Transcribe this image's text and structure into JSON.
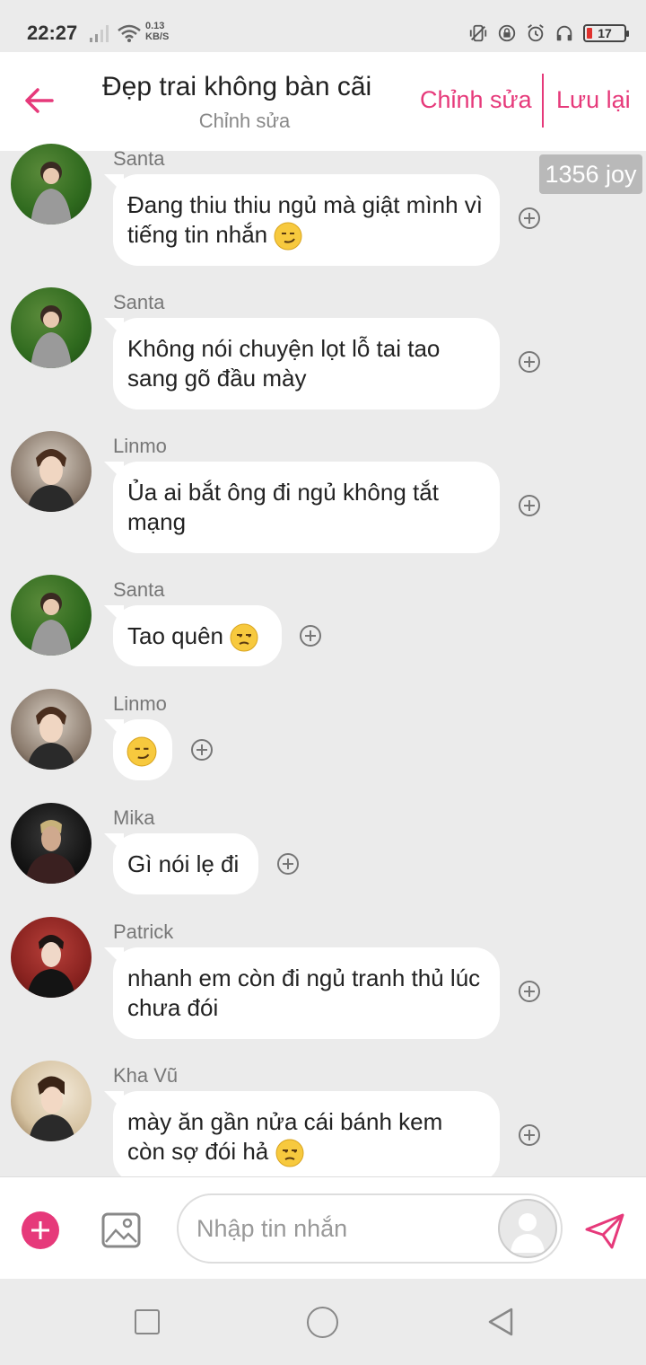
{
  "status_bar": {
    "time": "22:27",
    "speed_value": "0.13",
    "speed_unit": "KB/S",
    "battery": "17",
    "icons": [
      "signal-icon",
      "wifi-icon",
      "vibrate-icon",
      "lock-rotation-icon",
      "alarm-icon",
      "headphones-icon",
      "battery-icon"
    ]
  },
  "header": {
    "title": "Đẹp trai không bàn cãi",
    "subtitle": "Chỉnh sửa",
    "edit_label": "Chỉnh sửa",
    "save_label": "Lưu lại"
  },
  "joy_badge": "1356 joy",
  "messages": [
    {
      "sender": "Santa",
      "text": "Đang thiu thiu ngủ mà giật mình vì tiếng tin nhắn",
      "emoji": "smirk"
    },
    {
      "sender": "Santa",
      "text": "Không nói chuyện lọt lỗ tai tao sang gõ đầu mày",
      "emoji": ""
    },
    {
      "sender": "Linmo",
      "text": "Ủa ai bắt ông đi ngủ không tắt mạng",
      "emoji": ""
    },
    {
      "sender": "Santa",
      "text": "Tao quên",
      "emoji": "unamused"
    },
    {
      "sender": "Linmo",
      "text": "",
      "emoji": "smirk"
    },
    {
      "sender": "Mika",
      "text": "Gì nói lẹ đi",
      "emoji": ""
    },
    {
      "sender": "Patrick",
      "text": "nhanh em còn đi ngủ tranh thủ lúc chưa đói",
      "emoji": ""
    },
    {
      "sender": "Kha Vũ",
      "text": "mày ăn gần nửa cái bánh kem còn sợ đói hả",
      "emoji": "unamused"
    }
  ],
  "input": {
    "placeholder": "Nhập tin nhắn"
  },
  "colors": {
    "accent": "#e6397a",
    "background": "#ebebeb",
    "bubble": "#ffffff"
  }
}
